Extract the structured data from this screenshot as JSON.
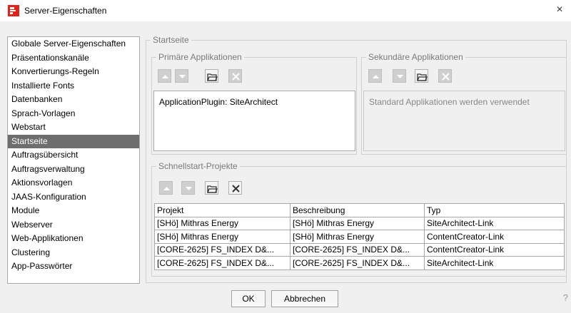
{
  "window": {
    "title": "Server-Eigenschaften",
    "close_glyph": "×"
  },
  "nav": {
    "items": [
      "Globale Server-Eigenschaften",
      "Präsentationskanäle",
      "Konvertierungs-Regeln",
      "Installierte Fonts",
      "Datenbanken",
      "Sprach-Vorlagen",
      "Webstart",
      "Startseite",
      "Auftragsübersicht",
      "Auftragsverwaltung",
      "Aktionsvorlagen",
      "JAAS-Konfiguration",
      "Module",
      "Webserver",
      "Web-Applikationen",
      "Clustering",
      "App-Passwörter"
    ],
    "selected": "Startseite"
  },
  "startseite": {
    "legend": "Startseite",
    "primary": {
      "legend": "Primäre Applikationen",
      "entries": [
        "ApplicationPlugin: SiteArchitect"
      ]
    },
    "secondary": {
      "legend": "Sekundäre Applikationen",
      "placeholder": "Standard Applikationen werden verwendet"
    },
    "quickstart": {
      "legend": "Schnellstart-Projekte",
      "columns": [
        "Projekt",
        "Beschreibung",
        "Typ"
      ],
      "rows": [
        [
          "[SHö] Mithras Energy",
          "[SHö] Mithras Energy",
          "SiteArchitect-Link"
        ],
        [
          "[SHö] Mithras Energy",
          "[SHö] Mithras Energy",
          "ContentCreator-Link"
        ],
        [
          "[CORE-2625] FS_INDEX D&...",
          "[CORE-2625] FS_INDEX D&...",
          "ContentCreator-Link"
        ],
        [
          "[CORE-2625] FS_INDEX D&...",
          "[CORE-2625] FS_INDEX D&...",
          "SiteArchitect-Link"
        ]
      ]
    }
  },
  "buttons": {
    "ok": "OK",
    "cancel": "Abbrechen",
    "help": "?"
  },
  "colors": {
    "brand": "#e2231a",
    "selection": "#6e6e6e"
  },
  "icons": [
    "app-logo-icon",
    "close-icon",
    "move-up-icon",
    "move-down-icon",
    "open-folder-icon",
    "delete-icon",
    "help-icon"
  ]
}
